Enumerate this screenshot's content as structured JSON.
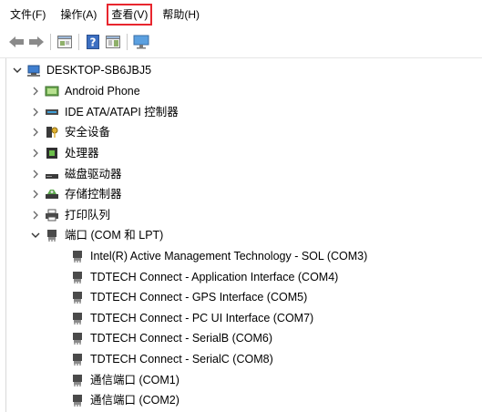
{
  "menubar": {
    "items": [
      "文件(F)",
      "操作(A)",
      "查看(V)",
      "帮助(H)"
    ],
    "highlighted_index": 2,
    "highlight_color": "#e8262e"
  },
  "toolbar": {
    "buttons": [
      "back-arrow-icon",
      "forward-arrow-icon",
      "properties-icon",
      "help-icon",
      "console-tree-icon",
      "monitor-icon"
    ]
  },
  "tree": {
    "root": {
      "label": "DESKTOP-SB6JBJ5",
      "expanded": true,
      "icon": "computer-icon"
    },
    "categories": [
      {
        "label": "Android Phone",
        "expanded": false,
        "icon": "android-phone-icon"
      },
      {
        "label": "IDE ATA/ATAPI 控制器",
        "expanded": false,
        "icon": "ide-controller-icon"
      },
      {
        "label": "安全设备",
        "expanded": false,
        "icon": "security-device-icon"
      },
      {
        "label": "处理器",
        "expanded": false,
        "icon": "processor-icon"
      },
      {
        "label": "磁盘驱动器",
        "expanded": false,
        "icon": "disk-drive-icon"
      },
      {
        "label": "存储控制器",
        "expanded": false,
        "icon": "storage-controller-icon"
      },
      {
        "label": "打印队列",
        "expanded": false,
        "icon": "print-queue-icon"
      },
      {
        "label": "端口 (COM 和 LPT)",
        "expanded": true,
        "icon": "port-icon"
      }
    ],
    "ports": [
      "Intel(R) Active Management Technology - SOL (COM3)",
      "TDTECH Connect - Application Interface (COM4)",
      "TDTECH Connect - GPS Interface (COM5)",
      "TDTECH Connect - PC UI Interface (COM7)",
      "TDTECH Connect - SerialB (COM6)",
      "TDTECH Connect - SerialC (COM8)",
      "通信端口 (COM1)",
      "通信端口 (COM2)"
    ]
  }
}
